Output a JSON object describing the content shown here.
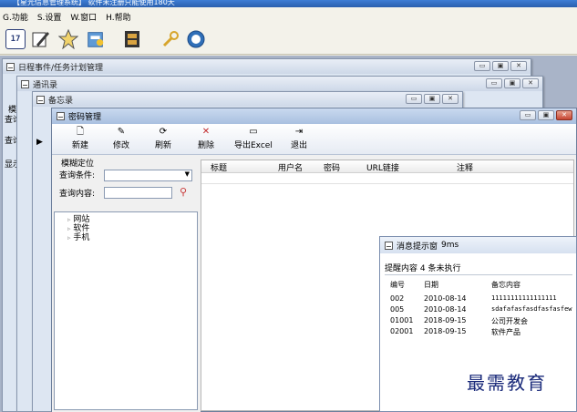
{
  "app": {
    "title": "【星光信息管理系统】 软件未注册只能使用180天"
  },
  "menu": [
    "G.功能",
    "S.设置",
    "W.窗口",
    "H.帮助"
  ],
  "toolbar": {
    "icons": [
      "calendar-icon",
      "pencil-icon",
      "badge-icon",
      "notebook-icon",
      "filmstrip-icon",
      "tools-icon",
      "help-icon"
    ],
    "calendar_day": "17"
  },
  "windows": {
    "schedule": {
      "title": "日程事件/任务计划管理",
      "left_labels": [
        "模",
        "查询",
        "查询",
        "显示"
      ]
    },
    "contacts": {
      "title": "通讯录"
    },
    "memo": {
      "title": "备忘录"
    }
  },
  "password_manager": {
    "title": "密码管理",
    "buttons": [
      {
        "label": "新建",
        "icon": "new-icon"
      },
      {
        "label": "修改",
        "icon": "edit-icon"
      },
      {
        "label": "刷新",
        "icon": "refresh-icon"
      },
      {
        "label": "删除",
        "icon": "delete-icon"
      },
      {
        "label": "导出Excel",
        "icon": "export-icon"
      },
      {
        "label": "退出",
        "icon": "exit-icon"
      }
    ],
    "filter": {
      "heading": "模糊定位",
      "condition_label": "查询条件:",
      "condition_value": "",
      "content_label": "查询内容:",
      "content_value": ""
    },
    "tree": [
      "网站",
      "软件",
      "手机"
    ],
    "columns": [
      "标题",
      "用户名",
      "密码",
      "URL链接",
      "注释"
    ]
  },
  "popup": {
    "title": "消息提示窗",
    "time": "9ms",
    "summary": "提醒内容 4 条未执行",
    "columns": [
      "编号",
      "日期",
      "备忘内容"
    ],
    "rows": [
      {
        "id": "002",
        "date": "2010-08-14",
        "content": "11111111111111111"
      },
      {
        "id": "005",
        "date": "2010-08-14",
        "content": "sdafafasfasdfasfasfew"
      },
      {
        "id": "01001",
        "date": "2018-09-15",
        "content": "公司开发会"
      },
      {
        "id": "02001",
        "date": "2018-09-15",
        "content": "软件产品"
      }
    ]
  },
  "watermark": "最需教育"
}
